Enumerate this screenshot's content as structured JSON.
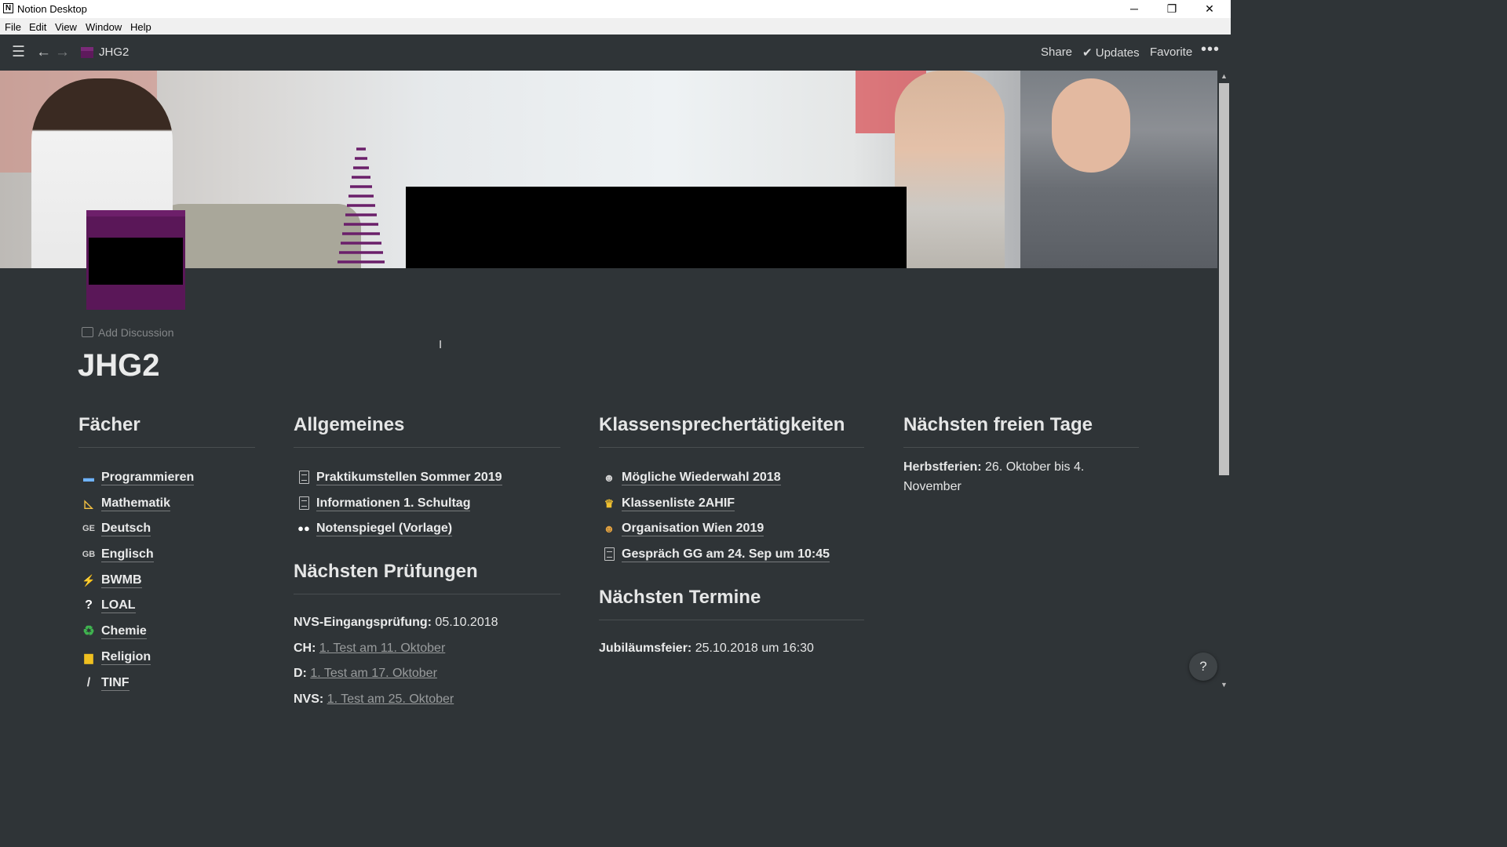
{
  "window": {
    "title": "Notion Desktop",
    "logo_letter": "N",
    "minimize": "─",
    "maximize": "❐",
    "close": "✕"
  },
  "menu": [
    "File",
    "Edit",
    "View",
    "Window",
    "Help"
  ],
  "topbar": {
    "breadcrumb": "JHG2",
    "share": "Share",
    "updates": "Updates",
    "favorite": "Favorite",
    "more": "•••"
  },
  "page": {
    "add_discussion": "Add Discussion",
    "title": "JHG2"
  },
  "faecher": {
    "heading": "Fächer",
    "items": [
      {
        "icon": "laptop-icon",
        "glyph": "▬",
        "color": "#6fb3ff",
        "label": "Programmieren"
      },
      {
        "icon": "triangle-ruler-icon",
        "glyph": "◺",
        "color": "#f5c242",
        "label": "Mathematik"
      },
      {
        "icon": "ge-text-icon",
        "glyph": "GE",
        "color": "#cfcfcf",
        "label": "Deutsch"
      },
      {
        "icon": "gb-text-icon",
        "glyph": "GB",
        "color": "#cfcfcf",
        "label": "Englisch"
      },
      {
        "icon": "lightning-icon",
        "glyph": "⚡",
        "color": "#f7c531",
        "label": "BWMB"
      },
      {
        "icon": "question-icon",
        "glyph": "?",
        "color": "#ffffff",
        "label": "LOAL"
      },
      {
        "icon": "recycle-icon",
        "glyph": "♻",
        "color": "#3fb34f",
        "label": "Chemie"
      },
      {
        "icon": "menorah-icon",
        "glyph": "▆",
        "color": "#f0c020",
        "label": "Religion"
      },
      {
        "icon": "pencil-icon",
        "glyph": "/",
        "color": "#e0e0e0",
        "label": "TINF"
      }
    ]
  },
  "allgemeines": {
    "heading": "Allgemeines",
    "items": [
      {
        "icon": "document-icon",
        "label": "Praktikumstellen Sommer 2019"
      },
      {
        "icon": "document-icon",
        "label": "Informationen 1. Schultag"
      },
      {
        "icon": "eyes-icon",
        "glyph": "👀",
        "label": "Notenspiegel (Vorlage)"
      }
    ]
  },
  "pruefungen": {
    "heading": "Nächsten Prüfungen",
    "lines": [
      {
        "label": "NVS-Eingangsprüfung:",
        "value": " 05.10.2018",
        "link": ""
      },
      {
        "label": "CH:",
        "value": " ",
        "link": "1. Test am 11. Oktober"
      },
      {
        "label": "D:",
        "value": " ",
        "link": "1. Test am 17. Oktober"
      },
      {
        "label": "NVS:",
        "value": " ",
        "link": "1. Test am 25. Oktober"
      }
    ]
  },
  "klassensprecher": {
    "heading": "Klassensprechertätigkeiten",
    "items": [
      {
        "icon": "person-icon",
        "glyph": "👤",
        "label": "Mögliche Wiederwahl 2018"
      },
      {
        "icon": "trophy-icon",
        "glyph": "🏆",
        "label": "Klassenliste 2AHIF"
      },
      {
        "icon": "people-icon",
        "glyph": "👥",
        "label": "Organisation Wien 2019"
      },
      {
        "icon": "document-icon",
        "label": "Gespräch GG am 24. Sep um 10:45"
      }
    ]
  },
  "termine": {
    "heading": "Nächsten Termine",
    "lines": [
      {
        "label": "Jubiläumsfeier:",
        "value": " 25.10.2018 um 16:30"
      }
    ]
  },
  "freie_tage": {
    "heading": "Nächsten freien Tage",
    "label": "Herbstferien:",
    "value": " 26. Oktober bis 4. November"
  },
  "help": "?"
}
